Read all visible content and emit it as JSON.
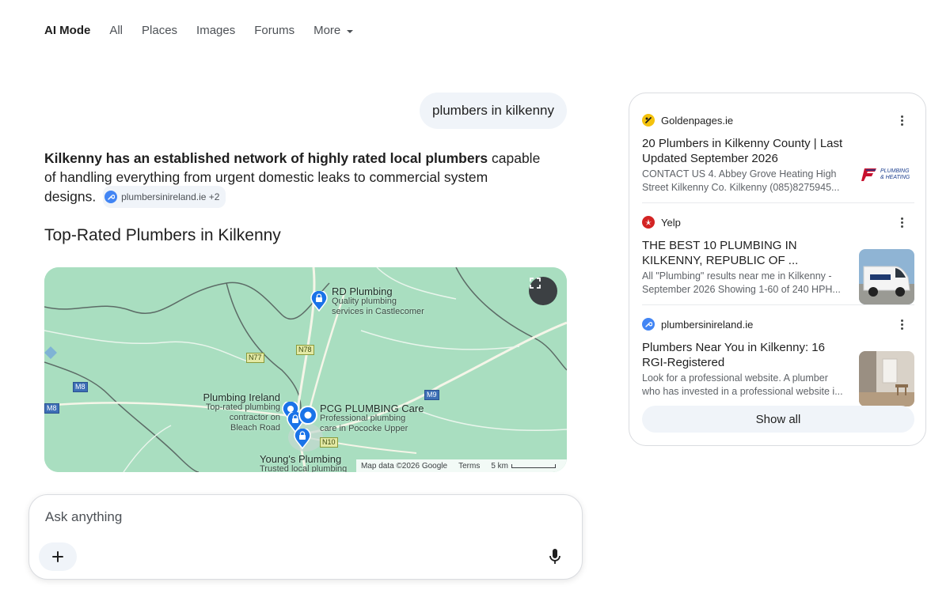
{
  "nav": {
    "items": [
      {
        "label": "AI Mode",
        "active": true
      },
      {
        "label": "All"
      },
      {
        "label": "Places"
      },
      {
        "label": "Images"
      },
      {
        "label": "Forums"
      }
    ],
    "more_label": "More"
  },
  "query": "plumbers in kilkenny",
  "answer": {
    "bold": "Kilkenny has an established network of highly rated local plumbers",
    "rest": " capable of handling everything from urgent domestic leaks to commercial system designs.",
    "chip_label": "plumbersinireland.ie +2"
  },
  "section_heading": "Top-Rated Plumbers in Kilkenny",
  "map": {
    "places": [
      {
        "name": "RD Plumbing",
        "desc1": "Quality plumbing",
        "desc2": "services in Castlecomer"
      },
      {
        "name": "Plumbing Ireland",
        "desc1": "Top-rated plumbing",
        "desc2": "contractor on",
        "desc3": "Bleach Road"
      },
      {
        "name": "PCG PLUMBING Care",
        "desc1": "Professional plumbing",
        "desc2": "care in Pococke Upper"
      },
      {
        "name": "Young's Plumbing",
        "desc1": "Trusted local plumbing"
      }
    ],
    "roads": [
      "N77",
      "N78",
      "M8",
      "M8",
      "M9",
      "N10"
    ],
    "footer": {
      "attribution": "Map data ©2026 Google",
      "terms": "Terms",
      "scale": "5 km"
    }
  },
  "ask": {
    "placeholder": "Ask anything"
  },
  "sources": [
    {
      "site": "Goldenpages.ie",
      "title": "20 Plumbers in Kilkenny County | Last Updated September 2026",
      "snippet": "CONTACT US 4. Abbey Grove Heating High Street Kilkenny Co. Kilkenny (085)8275945...",
      "thumb_text": "PLUMBING & HEATING",
      "favicon_color": "#f4c20d"
    },
    {
      "site": "Yelp",
      "title": "THE BEST 10 PLUMBING IN KILKENNY, REPUBLIC OF ...",
      "snippet": "All \"Plumbing\" results near me in Kilkenny - September 2026 Showing 1-60 of 240 HPH...",
      "favicon_color": "#d32323"
    },
    {
      "site": "plumbersinireland.ie",
      "title": "Plumbers Near You in Kilkenny: 16 RGI-Registered",
      "snippet": "Look for a professional website. A plumber who has invested in a professional website i...",
      "favicon_color": "#4285f4"
    }
  ],
  "show_all_label": "Show all"
}
